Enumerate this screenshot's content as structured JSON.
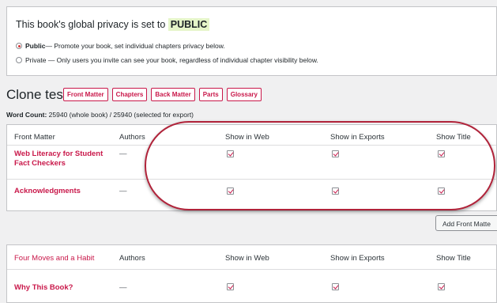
{
  "privacy": {
    "prefix": "This book's global privacy is set to ",
    "status": "PUBLIC",
    "options": [
      {
        "bold": "Public",
        "text": " — Promote your book, set individual chapters privacy below.",
        "selected": true
      },
      {
        "bold": "",
        "text": "Private — Only users you invite can see your book, regardless of individual chapter visibility below.",
        "selected": false
      }
    ]
  },
  "book": {
    "title": "Clone test",
    "tabs": [
      "Front Matter",
      "Chapters",
      "Back Matter",
      "Parts",
      "Glossary"
    ],
    "word_count_label": "Word Count:",
    "word_count_value": " 25940 (whole book) / 25940 (selected for export)"
  },
  "front_matter_table": {
    "headers": [
      "Front Matter",
      "Authors",
      "Show in Web",
      "Show in Exports",
      "Show Title"
    ],
    "rows": [
      {
        "title": "Web Literacy for Student Fact Checkers",
        "authors": "—"
      },
      {
        "title": "Acknowledgments",
        "authors": "—"
      }
    ],
    "add_button": "Add Front Matte"
  },
  "part_table": {
    "headers": [
      "Four Moves and a Habit",
      "Authors",
      "Show in Web",
      "Show in Exports",
      "Show Title"
    ],
    "rows": [
      {
        "title": "Why This Book?",
        "authors": "—"
      }
    ]
  },
  "colors": {
    "accent": "#c9184a",
    "highlight_ring": "#b0233a",
    "public_badge": "#e5f5c9"
  }
}
